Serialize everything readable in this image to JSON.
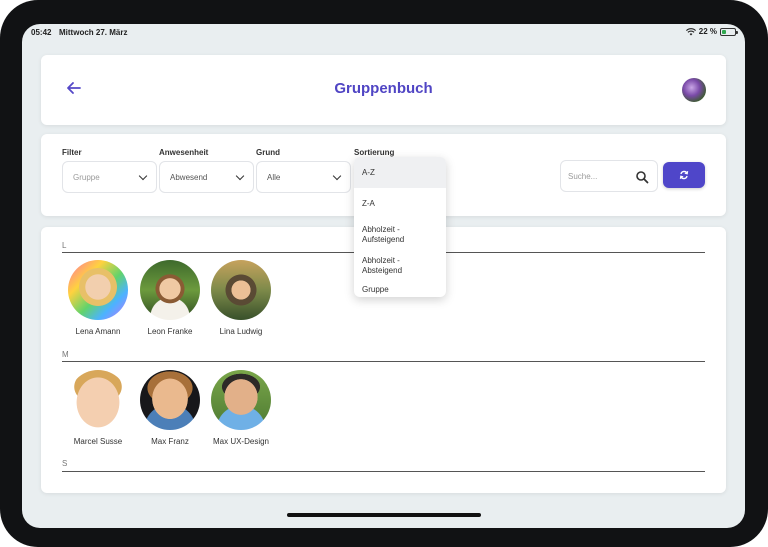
{
  "status_bar": {
    "time": "05:42",
    "date": "Mittwoch 27. März",
    "battery": "22 %"
  },
  "header": {
    "title": "Gruppenbuch",
    "back_icon": "arrow-left-icon"
  },
  "filters": [
    {
      "label": "Filter",
      "value": "Gruppe",
      "is_placeholder": true
    },
    {
      "label": "Anwesenheit",
      "value": "Abwesend"
    },
    {
      "label": "Grund",
      "value": "Alle"
    },
    {
      "label": "Sortierung",
      "value": ""
    }
  ],
  "search": {
    "placeholder": "Suche..."
  },
  "sort_options": [
    "A-Z",
    "Z-A",
    "Abholzeit - Aufsteigend",
    "Abholzeit - Absteigend",
    "Gruppe"
  ],
  "sections": [
    {
      "letter": "L",
      "children": [
        {
          "name": "Lena Amann"
        },
        {
          "name": "Leon Franke"
        },
        {
          "name": "Lina Ludwig"
        }
      ]
    },
    {
      "letter": "M",
      "children": [
        {
          "name": "Marcel Susse"
        },
        {
          "name": "Max Franz"
        },
        {
          "name": "Max UX-Design"
        }
      ]
    },
    {
      "letter": "S",
      "children": []
    }
  ],
  "colors": {
    "accent": "#4f46c9",
    "title": "#5045c4",
    "background": "#e9eef0"
  }
}
